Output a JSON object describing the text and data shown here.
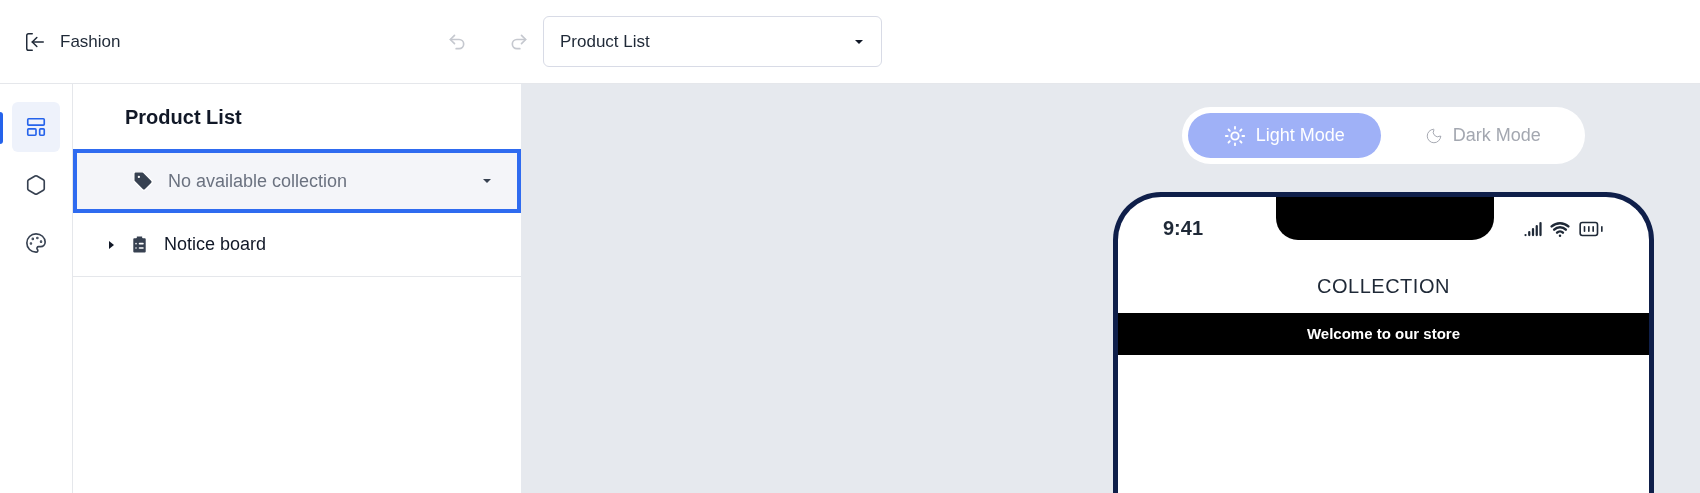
{
  "header": {
    "back_label": "Fashion",
    "undo": {
      "disabled": true
    },
    "redo": {
      "disabled": true
    },
    "page_select": {
      "value": "Product List"
    }
  },
  "rail": [
    {
      "kind": "layout",
      "selected": true
    },
    {
      "kind": "settings",
      "selected": false
    },
    {
      "kind": "palette",
      "selected": false
    }
  ],
  "panel": {
    "title": "Product List",
    "items": [
      {
        "kind": "select",
        "label": "No available collection",
        "selected": true
      },
      {
        "kind": "group",
        "label": "Notice board",
        "expanded": false,
        "selected": false
      }
    ]
  },
  "preview": {
    "modes": [
      {
        "kind": "light",
        "label": "Light Mode",
        "selected": true
      },
      {
        "kind": "dark",
        "label": "Dark Mode",
        "selected": false
      }
    ],
    "phone": {
      "time": "9:41",
      "title": "COLLECTION",
      "banner": "Welcome to our store"
    }
  }
}
